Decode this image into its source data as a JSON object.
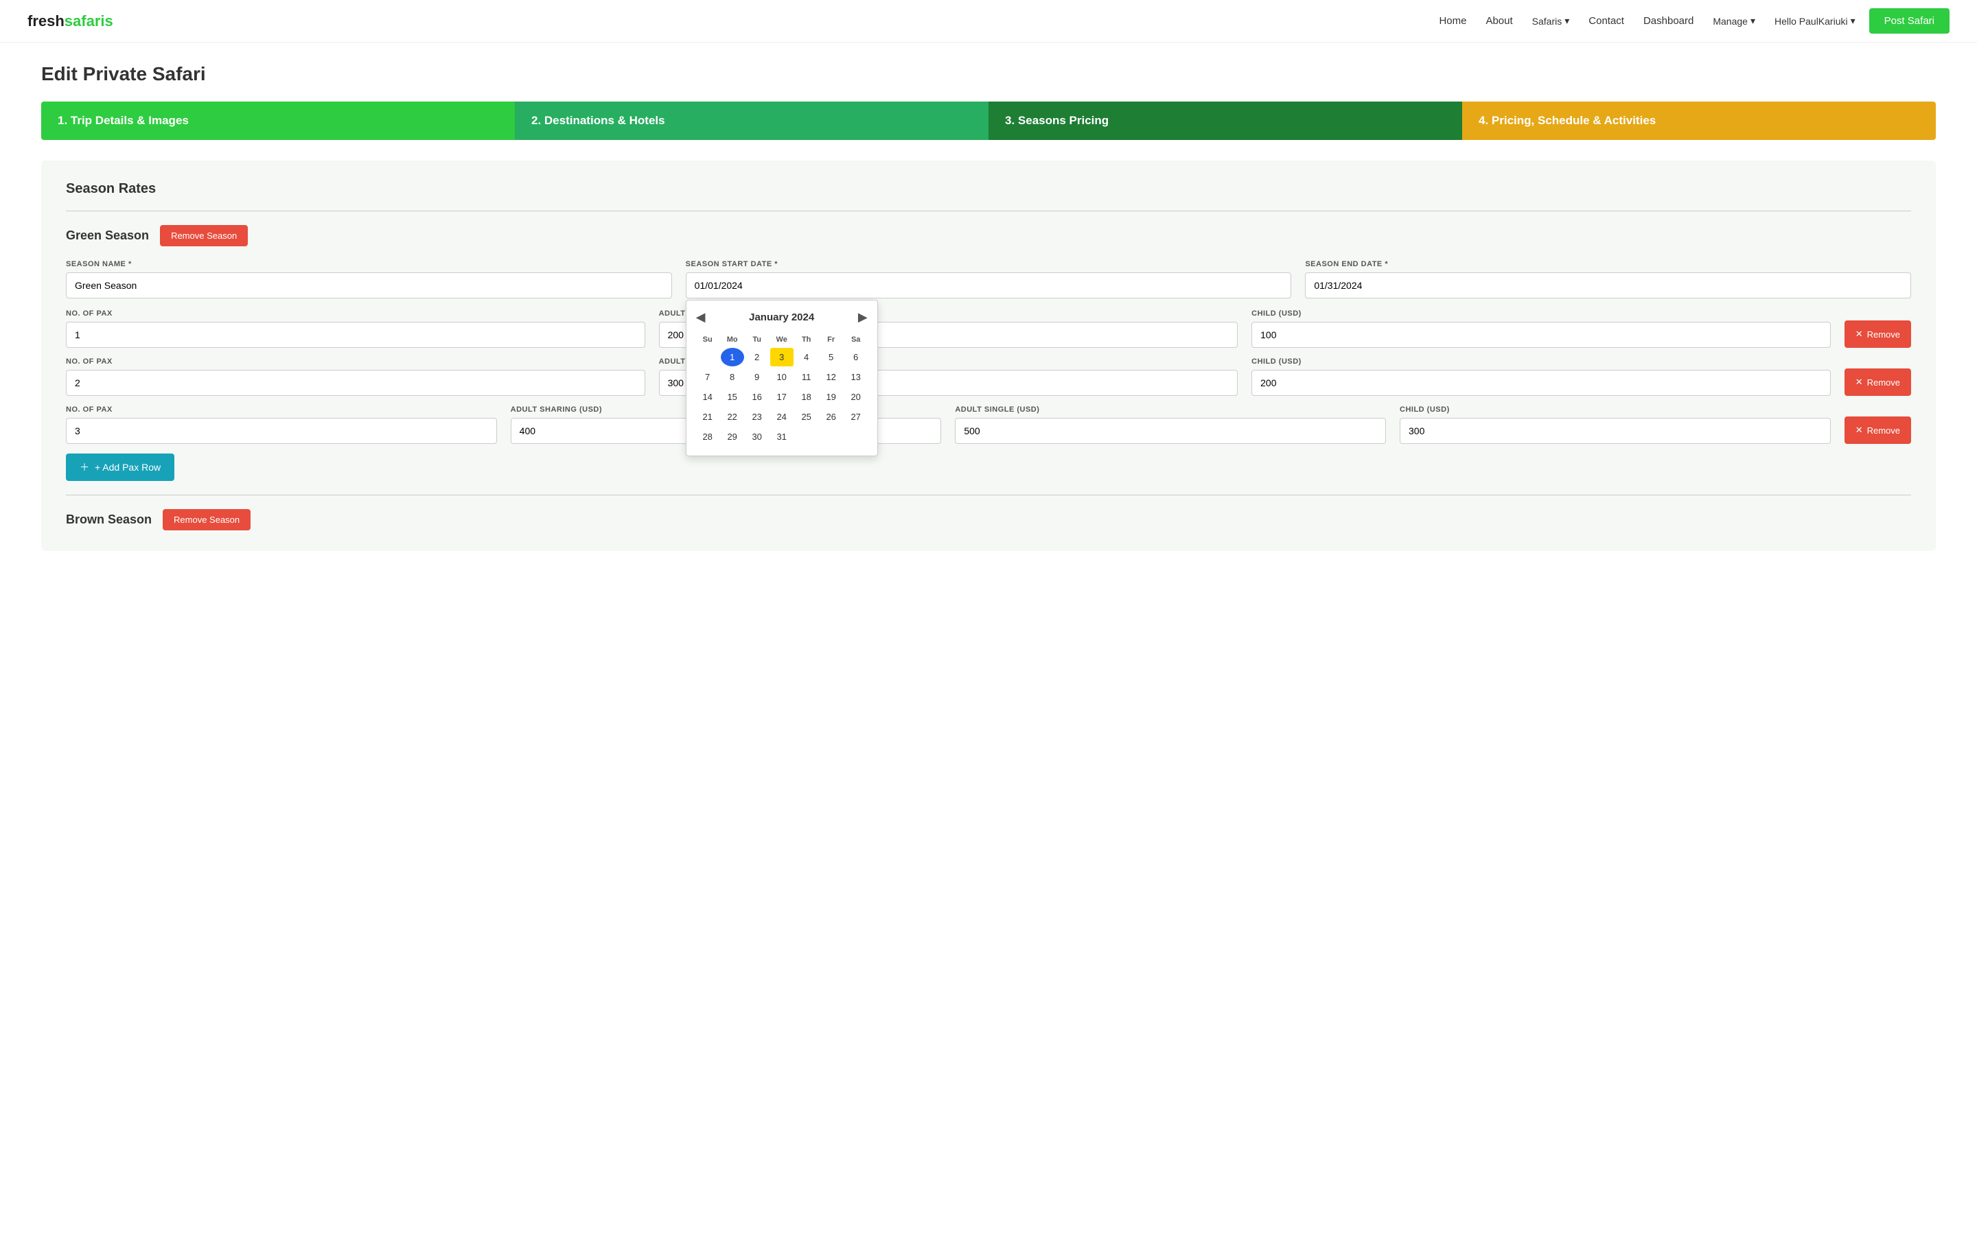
{
  "brand": {
    "name_part1": "fresh",
    "name_part2": "safaris"
  },
  "nav": {
    "links": [
      "Home",
      "About",
      "Safaris",
      "Contact",
      "Dashboard",
      "Manage"
    ],
    "user": "Hello PaulKariuki",
    "post_safari": "Post Safari"
  },
  "page": {
    "title": "Edit Private Safari"
  },
  "steps": [
    {
      "label": "1. Trip Details & Images"
    },
    {
      "label": "2. Destinations & Hotels"
    },
    {
      "label": "3. Seasons Pricing"
    },
    {
      "label": "4. Pricing, Schedule & Activities"
    }
  ],
  "section": {
    "title": "Season Rates"
  },
  "green_season": {
    "name": "Green Season",
    "remove_label": "Remove Season",
    "fields": {
      "season_name_label": "SEASON NAME *",
      "season_name_value": "Green Season",
      "start_date_label": "SEASON START DATE *",
      "start_date_value": "01/01/2024",
      "end_date_label": "SEASON END DATE *",
      "end_date_value": "01/31/2024"
    },
    "calendar": {
      "title": "January 2024",
      "day_headers": [
        "Su",
        "Mo",
        "Tu",
        "We",
        "Th",
        "Fr",
        "Sa"
      ],
      "weeks": [
        [
          null,
          "1",
          "2",
          "3",
          "4",
          "5",
          "6"
        ],
        [
          "7",
          "8",
          "9",
          "10",
          "11",
          "12",
          "13"
        ],
        [
          "14",
          "15",
          "16",
          "17",
          "18",
          "19",
          "20"
        ],
        [
          "21",
          "22",
          "23",
          "24",
          "25",
          "26",
          "27"
        ],
        [
          "28",
          "29",
          "30",
          "31",
          null,
          null,
          null
        ]
      ],
      "selected_day": "1",
      "highlighted_day": "3"
    },
    "pax_rows": [
      {
        "pax_label": "NO. OF PAX",
        "pax_value": "1",
        "adult_label": "ADULT SHARING (USD)",
        "adult_value": "200",
        "child_label": "CHILD (USD)",
        "child_value": "100",
        "remove_label": "Remove"
      },
      {
        "pax_label": "NO. OF PAX",
        "pax_value": "2",
        "adult_label": "ADULT SHARING (USD)",
        "adult_value": "300",
        "child_label": "CHILD (USD)",
        "child_value": "200",
        "remove_label": "Remove"
      },
      {
        "pax_label": "NO. OF PAX",
        "pax_value": "3",
        "adult_label": "ADULT SHARING (USD)",
        "adult_value": "400",
        "adult_single_label": "ADULT SINGLE (USD)",
        "adult_single_value": "500",
        "child_label": "CHILD (USD)",
        "child_value": "300",
        "remove_label": "Remove"
      }
    ],
    "add_pax_label": "+ Add Pax Row"
  },
  "brown_season": {
    "name": "Brown Season",
    "remove_label": "Remove Season"
  }
}
